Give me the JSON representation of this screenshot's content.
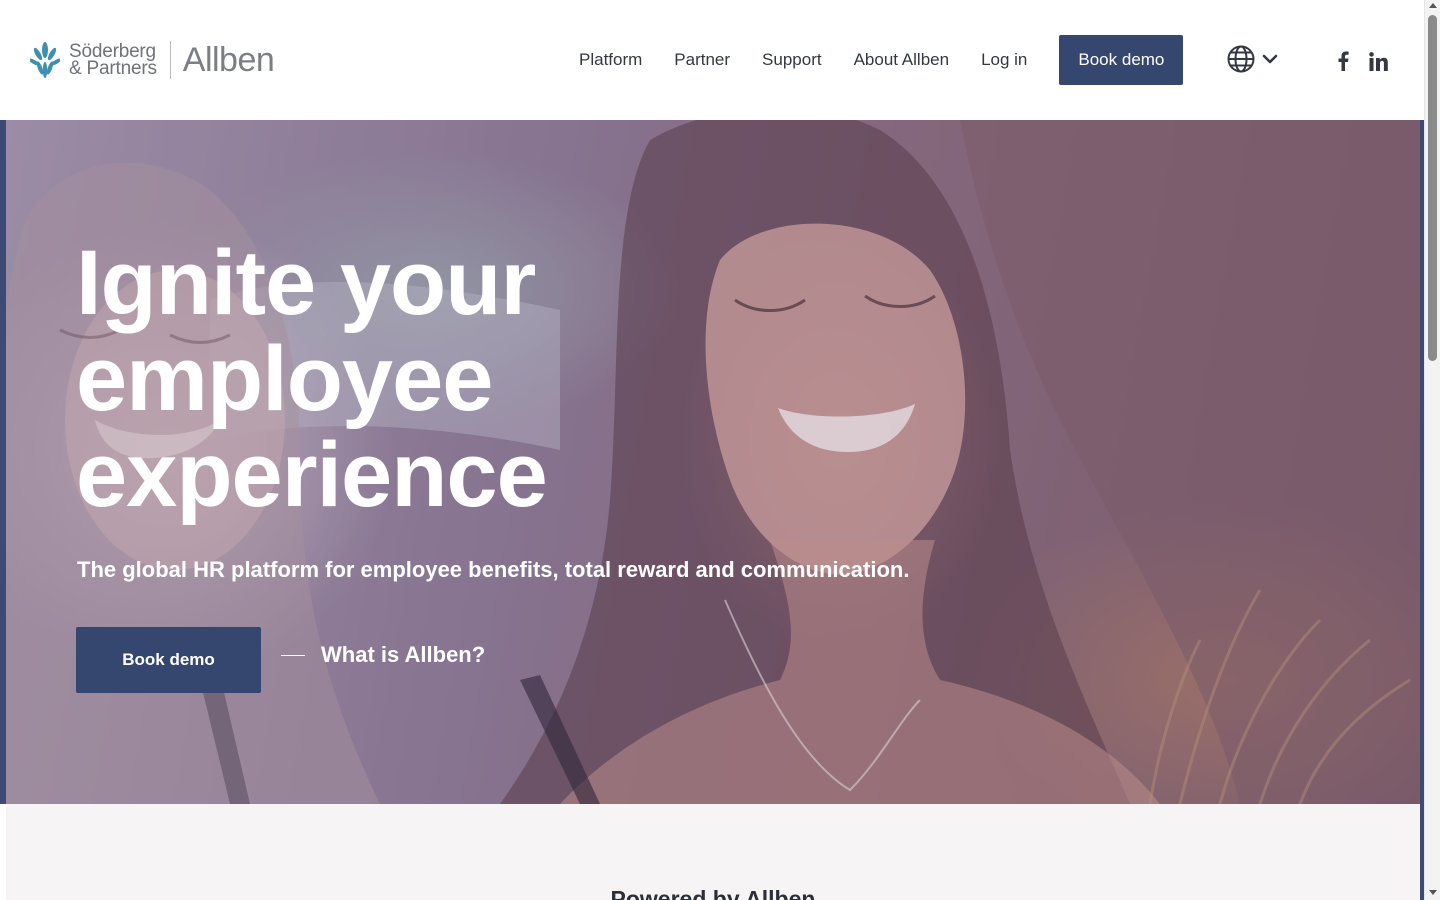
{
  "brand": {
    "parent_line1": "Söderberg",
    "parent_line2": "& Partners",
    "name": "Allben",
    "accent_color": "#35466f"
  },
  "nav": {
    "items": [
      {
        "label": "Platform"
      },
      {
        "label": "Partner"
      },
      {
        "label": "Support"
      },
      {
        "label": "About Allben"
      },
      {
        "label": "Log in"
      }
    ],
    "cta_label": "Book demo",
    "language_icon": "globe-icon",
    "language_dropdown_icon": "chevron-down-icon",
    "social": [
      {
        "icon": "facebook-icon"
      },
      {
        "icon": "linkedin-icon"
      }
    ]
  },
  "hero": {
    "title": "Ignite your employee experience",
    "subtitle": "The global HR platform for employee benefits, total reward and communication.",
    "cta_label": "Book demo",
    "secondary_link": "What is Allben?"
  },
  "section2": {
    "heading": "Powered by Allben"
  }
}
